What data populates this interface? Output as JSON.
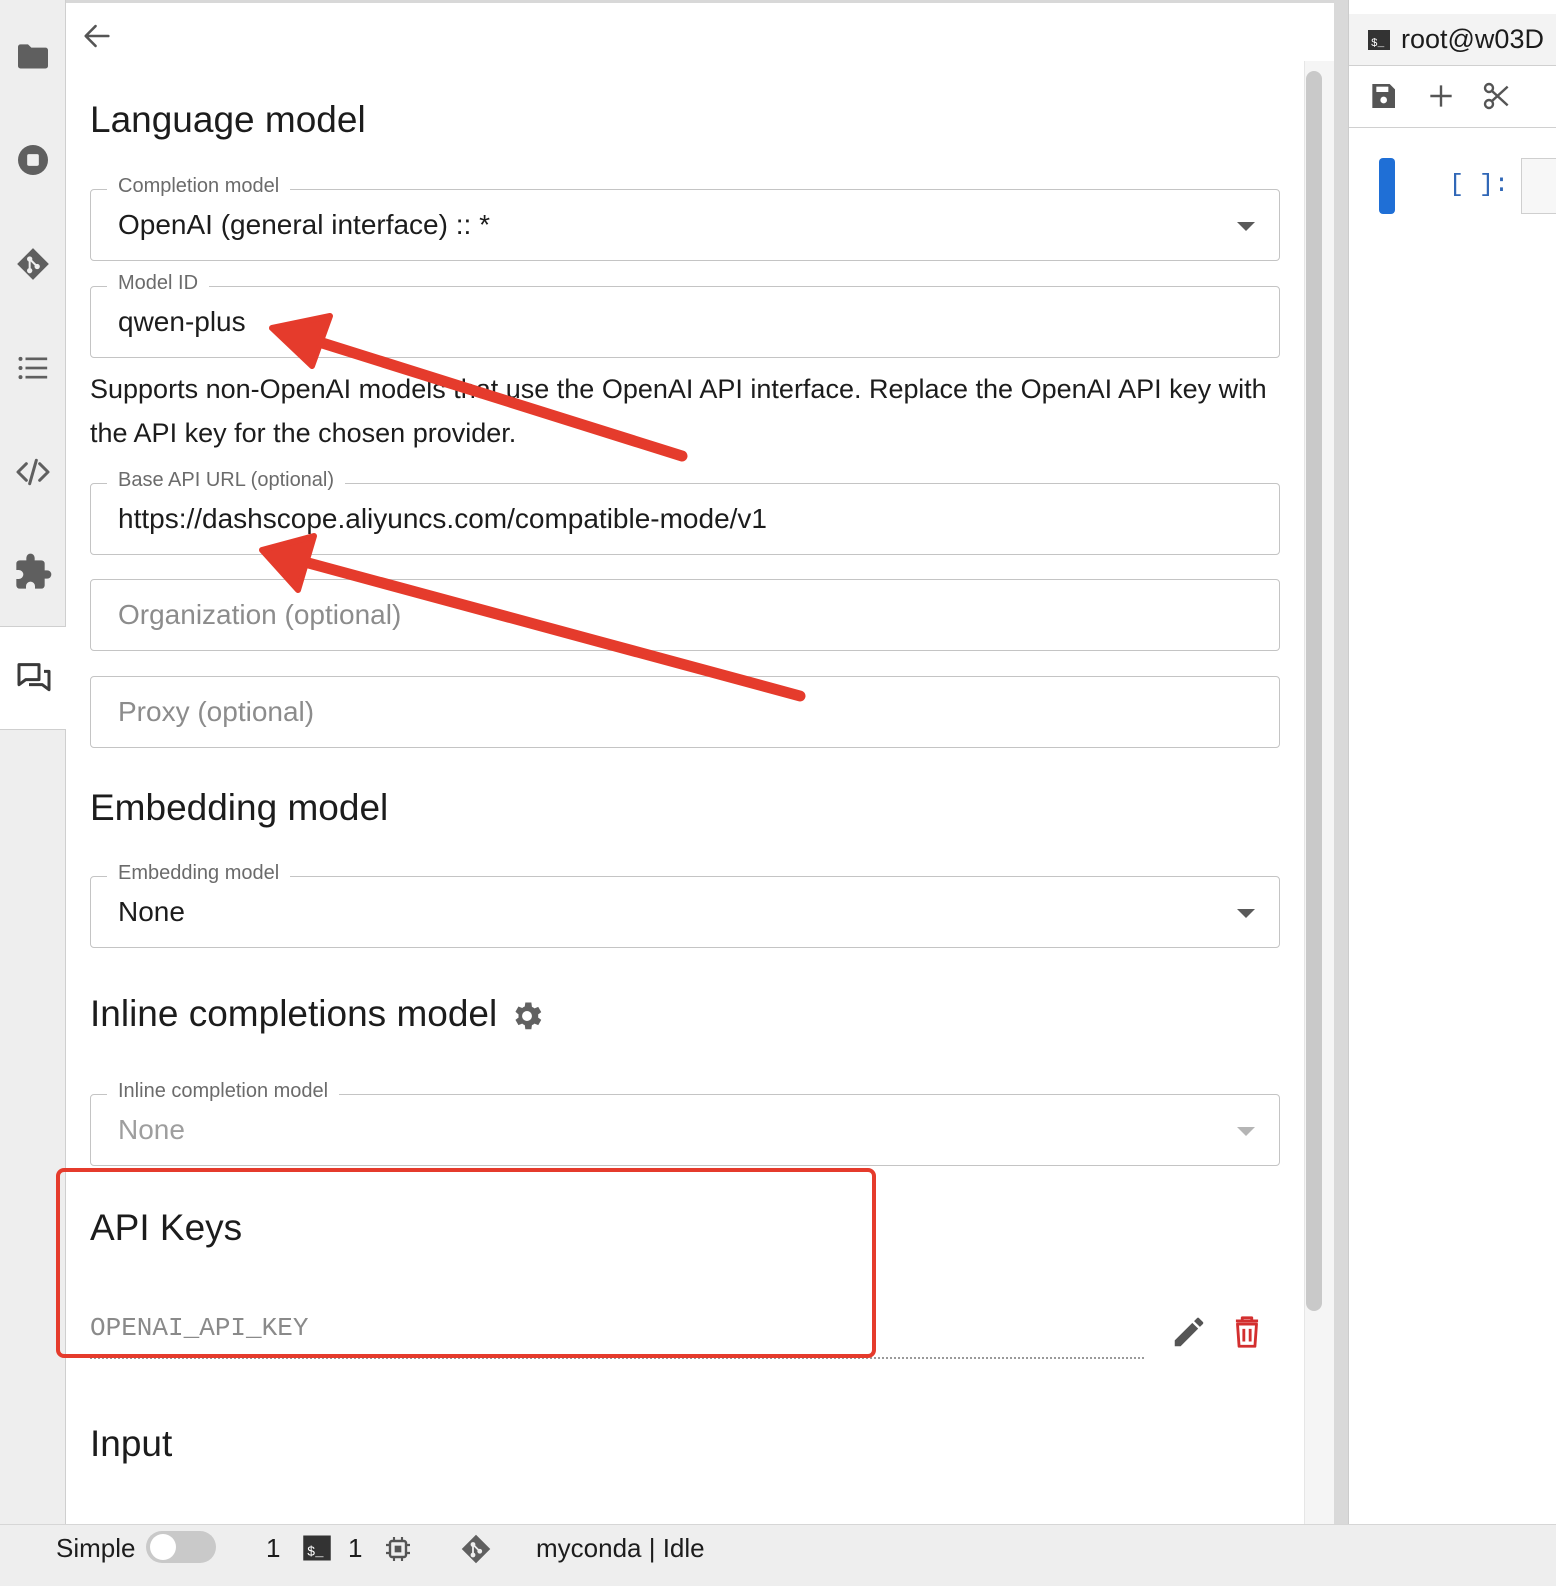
{
  "settings": {
    "language_model": {
      "heading": "Language model",
      "completion_model": {
        "label": "Completion model",
        "value": "OpenAI (general interface) :: *"
      },
      "model_id": {
        "label": "Model ID",
        "value": "qwen-plus"
      },
      "helper_text": "Supports non-OpenAI models that use the OpenAI API interface. Replace the OpenAI API key with the API key for the chosen provider.",
      "base_api_url": {
        "label": "Base API URL (optional)",
        "value": "https://dashscope.aliyuncs.com/compatible-mode/v1"
      },
      "organization": {
        "placeholder": "Organization (optional)"
      },
      "proxy": {
        "placeholder": "Proxy (optional)"
      }
    },
    "embedding_model": {
      "heading": "Embedding model",
      "select": {
        "label": "Embedding model",
        "value": "None"
      }
    },
    "inline_completions": {
      "heading": "Inline completions model",
      "select": {
        "label": "Inline completion model",
        "value": "None"
      }
    },
    "api_keys": {
      "heading": "API Keys",
      "key_name": "OPENAI_API_KEY"
    },
    "input": {
      "heading": "Input"
    }
  },
  "notebook": {
    "terminal_tab": "root@w03D",
    "cell_prompt": "[ ]:"
  },
  "status_bar": {
    "mode_label": "Simple",
    "mode_enabled": false,
    "kernels_count": "1",
    "terminals_count": "1",
    "kernel_status": "myconda | Idle"
  },
  "colors": {
    "annotation_red": "#e53b2c",
    "cell_accent": "#1f6fd6"
  },
  "icons": {
    "activity_bar": [
      "folder-icon",
      "stop-circle-icon",
      "git-icon",
      "table-of-contents-icon",
      "code-icon",
      "extension-icon",
      "chat-icon"
    ]
  }
}
